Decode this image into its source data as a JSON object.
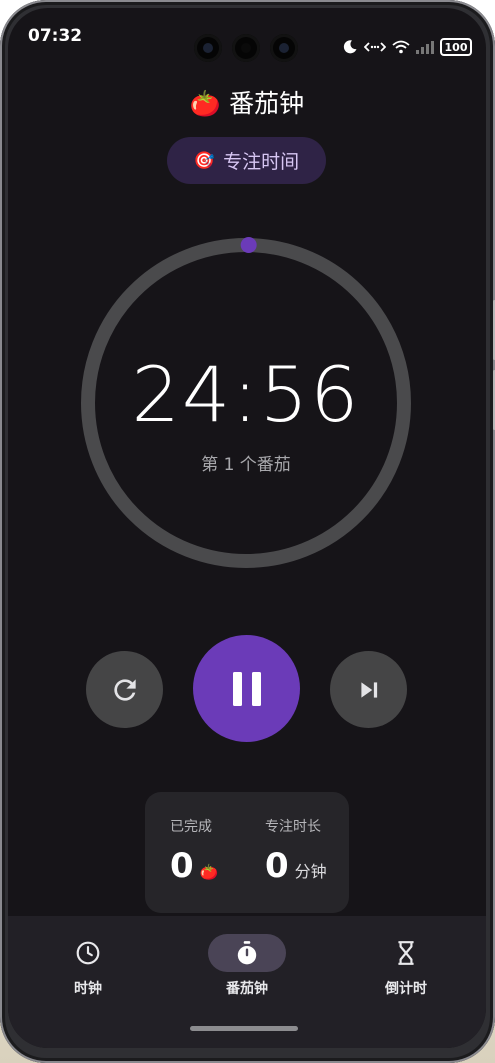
{
  "status_bar": {
    "time": "07:32",
    "battery": "100",
    "icons": [
      "moon-icon",
      "data-transfer-icon",
      "wifi-icon",
      "signal-icon",
      "battery-icon"
    ]
  },
  "header": {
    "title": "番茄钟",
    "emoji": "🍅"
  },
  "mode_chip": {
    "emoji": "🎯",
    "label": "专注时间",
    "color": "#2f2346"
  },
  "timer": {
    "display": "24:56",
    "session_label": "第 1 个番茄",
    "progress_fraction": 0.0027,
    "accent": "#6b3bb8"
  },
  "controls": {
    "reset_icon": "refresh-icon",
    "pause_icon": "pause-icon",
    "skip_icon": "skip-next-icon"
  },
  "stats": {
    "completed_label": "已完成",
    "completed_value": "0",
    "completed_emoji": "🍅",
    "focus_label": "专注时长",
    "focus_value": "0",
    "focus_unit": "分钟"
  },
  "nav": {
    "items": [
      {
        "label": "时钟",
        "icon": "clock-icon",
        "active": false
      },
      {
        "label": "番茄钟",
        "icon": "stopwatch-icon",
        "active": true
      },
      {
        "label": "倒计时",
        "icon": "hourglass-icon",
        "active": false
      }
    ]
  }
}
